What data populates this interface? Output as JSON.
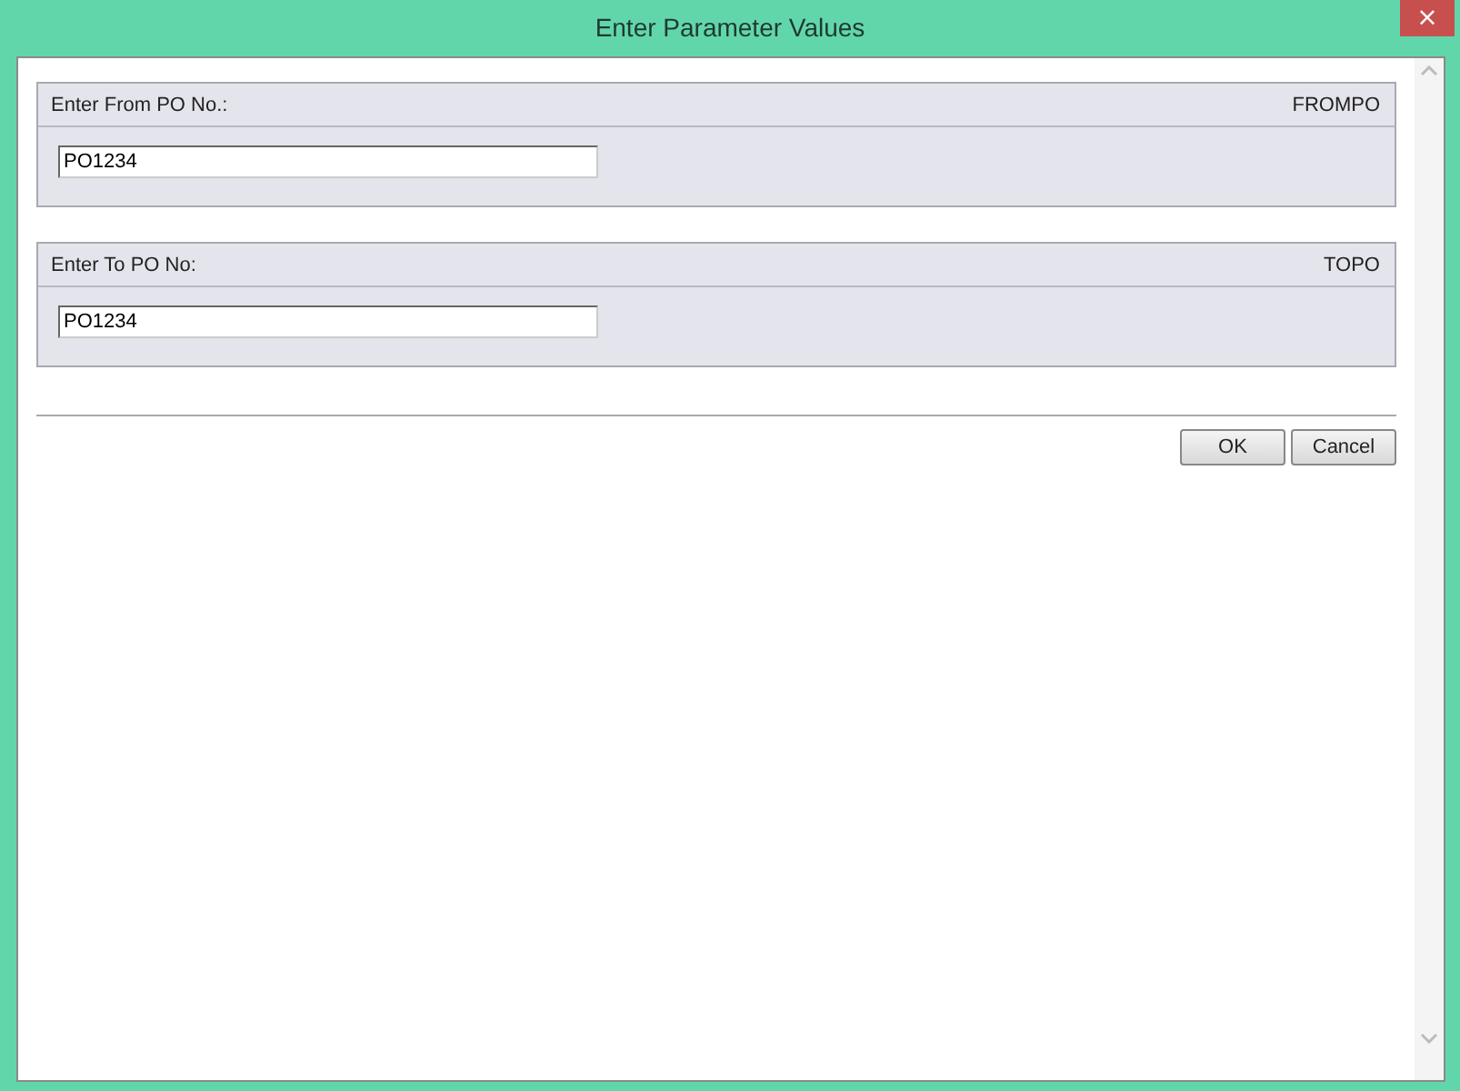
{
  "window": {
    "title": "Enter Parameter Values",
    "close_label": "×"
  },
  "parameters": [
    {
      "prompt": "Enter From PO No.:",
      "name": "FROMPO",
      "value": "PO1234"
    },
    {
      "prompt": "Enter To PO No:",
      "name": "TOPO",
      "value": "PO1234"
    }
  ],
  "buttons": [
    "OK",
    "Cancel"
  ]
}
